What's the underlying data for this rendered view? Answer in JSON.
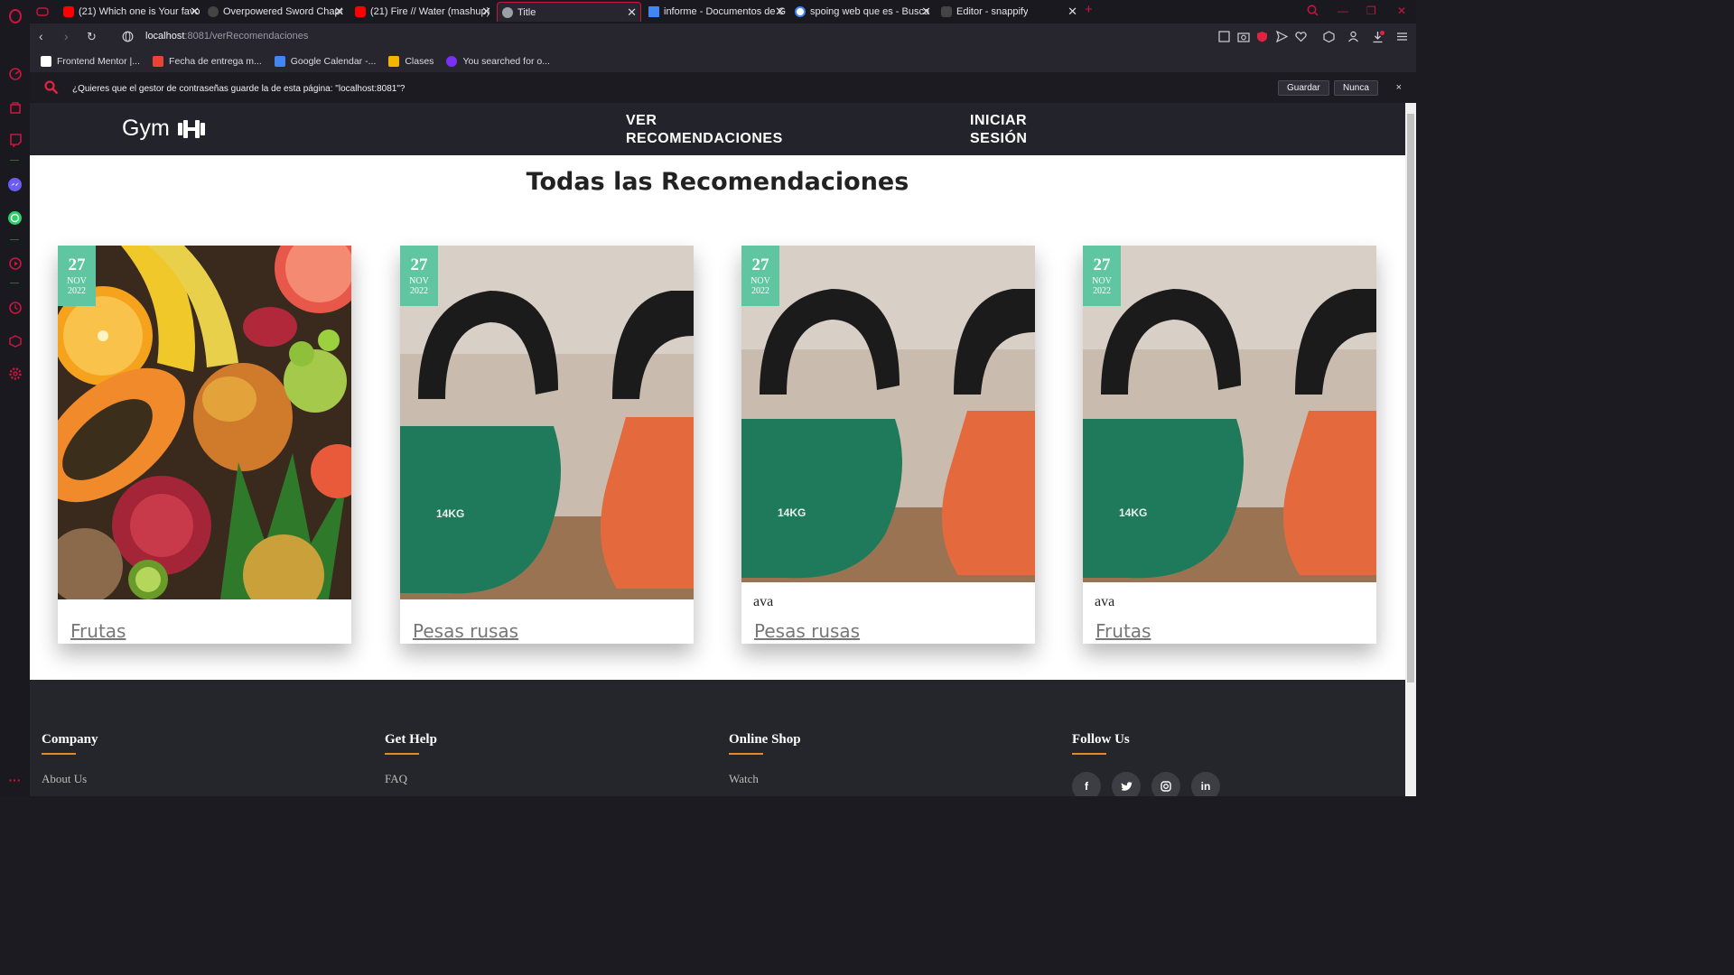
{
  "browser": {
    "tabs": [
      {
        "title": "(21) Which one is Your favo",
        "favicon": "youtube-icon",
        "color": "#ff0000"
      },
      {
        "title": "Overpowered Sword Chapt",
        "favicon": "globe-icon",
        "color": "#555555"
      },
      {
        "title": "(21) Fire // Water (mashup)",
        "favicon": "youtube-icon",
        "color": "#ff0000"
      },
      {
        "title": "Title",
        "favicon": "globe-icon",
        "color": "#9aa0a6",
        "active": true
      },
      {
        "title": "informe - Documentos de G",
        "favicon": "docs-icon",
        "color": "#4285f4"
      },
      {
        "title": "spoing web que es - Busca",
        "favicon": "google-icon",
        "color": "#ffffff"
      },
      {
        "title": "Editor - snappify",
        "favicon": "snappify-icon",
        "color": "#444444"
      }
    ],
    "new_tab": "+",
    "url_host": "localhost",
    "url_rest": ":8081/verRecomendaciones",
    "bookmarks": [
      {
        "label": "Frontend Mentor |...",
        "color": "#ffffff"
      },
      {
        "label": "Fecha de entrega m...",
        "color": "#ea4335"
      },
      {
        "label": "Google Calendar -...",
        "color": "#4285f4"
      },
      {
        "label": "Clases",
        "color": "#f4b400"
      },
      {
        "label": "You searched for o...",
        "color": "#7b2ff7"
      }
    ],
    "password_prompt": {
      "text": "¿Quieres que el gestor de contraseñas guarde la de esta página: \"localhost:8081\"?",
      "save": "Guardar",
      "never": "Nunca",
      "close": "×"
    }
  },
  "site": {
    "brand": "Gym",
    "nav": {
      "recommendations_line1": "VER",
      "recommendations_line2": "RECOMENDACIONES",
      "login_line1": "INICIAR",
      "login_line2": "SESIÓN"
    },
    "heading": "Todas las Recomendaciones",
    "cards": [
      {
        "day": "27",
        "month": "NOV",
        "year": "2022",
        "image": "fruits",
        "description": "",
        "title": "Frutas"
      },
      {
        "day": "27",
        "month": "NOV",
        "year": "2022",
        "image": "kettlebells",
        "weight_label": "14KG",
        "description": "",
        "title": "Pesas rusas"
      },
      {
        "day": "27",
        "month": "NOV",
        "year": "2022",
        "image": "kettlebells",
        "weight_label": "14KG",
        "description": "ava",
        "title": "Pesas rusas"
      },
      {
        "day": "27",
        "month": "NOV",
        "year": "2022",
        "image": "kettlebells",
        "weight_label": "14KG",
        "description": "ava",
        "title": "Frutas"
      }
    ],
    "footer": {
      "columns": [
        {
          "heading": "Company",
          "first_link": "About Us"
        },
        {
          "heading": "Get Help",
          "first_link": "FAQ"
        },
        {
          "heading": "Online Shop",
          "first_link": "Watch"
        },
        {
          "heading": "Follow Us"
        }
      ],
      "social": [
        "f",
        "t",
        "ig",
        "in"
      ]
    },
    "colors": {
      "nav_bg": "#23232b",
      "date_badge": "#5fc6a1",
      "footer_bg": "#24262b",
      "footer_accent": "#e28a2b",
      "browser_accent": "#c8163e"
    }
  }
}
